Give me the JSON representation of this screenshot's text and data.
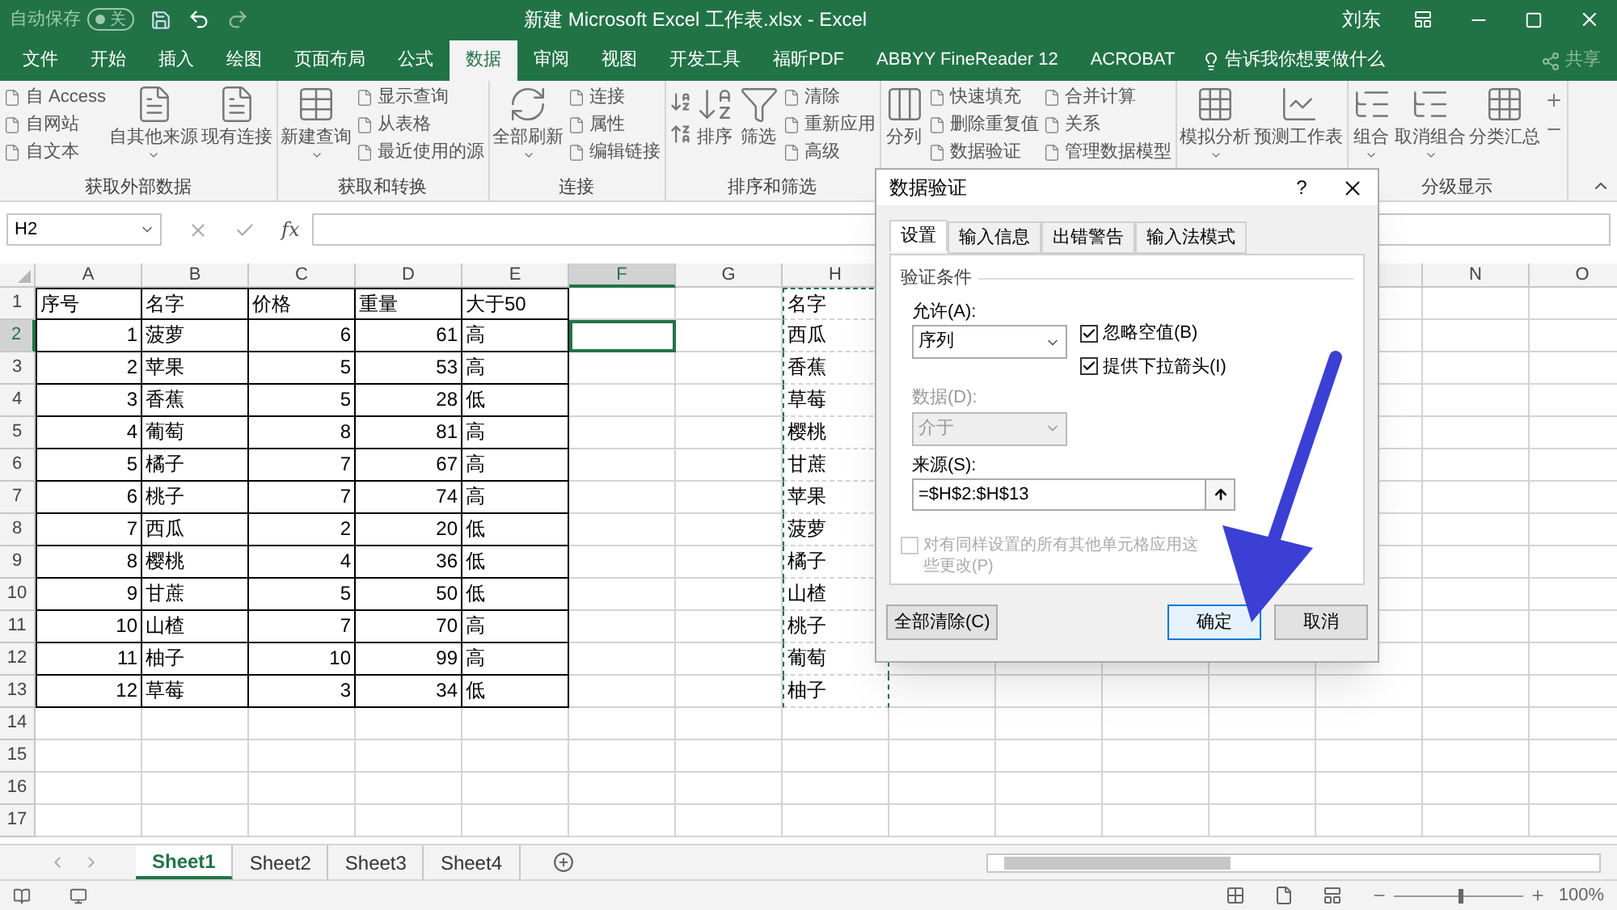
{
  "title_bar": {
    "autosave_label": "自动保存",
    "autosave_state": "关",
    "autosave_on": false,
    "document_title": "新建 Microsoft Excel 工作表.xlsx  -  Excel",
    "user": "刘东"
  },
  "ribbon_tabs": [
    {
      "label": "文件",
      "selected": false
    },
    {
      "label": "开始",
      "selected": false
    },
    {
      "label": "插入",
      "selected": false
    },
    {
      "label": "绘图",
      "selected": false
    },
    {
      "label": "页面布局",
      "selected": false
    },
    {
      "label": "公式",
      "selected": false
    },
    {
      "label": "数据",
      "selected": true
    },
    {
      "label": "审阅",
      "selected": false
    },
    {
      "label": "视图",
      "selected": false
    },
    {
      "label": "开发工具",
      "selected": false
    },
    {
      "label": "福昕PDF",
      "selected": false
    },
    {
      "label": "ABBYY FineReader 12",
      "selected": false
    },
    {
      "label": "ACROBAT",
      "selected": false
    }
  ],
  "tell_me": "告诉我你想要做什么",
  "share": "共享",
  "ribbon_groups": [
    {
      "label": "获取外部数据",
      "columns": [
        {
          "kind": "smalls",
          "items": [
            "自 Access",
            "自网站",
            "自文本"
          ]
        },
        {
          "kind": "large",
          "label": "自其他来源",
          "dropdown": true
        },
        {
          "kind": "large",
          "label": "现有连接",
          "dropdown": false
        }
      ]
    },
    {
      "label": "获取和转换",
      "columns": [
        {
          "kind": "large",
          "label": "新建查询",
          "dropdown": true
        },
        {
          "kind": "smalls",
          "items": [
            "显示查询",
            "从表格",
            "最近使用的源"
          ]
        }
      ]
    },
    {
      "label": "连接",
      "columns": [
        {
          "kind": "large",
          "label": "全部刷新",
          "dropdown": true
        },
        {
          "kind": "smalls",
          "items": [
            "连接",
            "属性",
            "编辑链接"
          ]
        }
      ]
    },
    {
      "label": "排序和筛选",
      "columns": [
        {
          "kind": "sort_icons"
        },
        {
          "kind": "large",
          "label": "排序",
          "dropdown": false
        },
        {
          "kind": "large",
          "label": "筛选",
          "dropdown": false
        },
        {
          "kind": "smalls",
          "items": [
            "清除",
            "重新应用",
            "高级"
          ]
        }
      ]
    },
    {
      "columns": [
        {
          "kind": "large",
          "label": "分列",
          "dropdown": false
        },
        {
          "kind": "smalls",
          "items": [
            "快速填充",
            "删除重复值",
            "数据验证"
          ]
        },
        {
          "kind": "smalls",
          "items": [
            "合并计算",
            "关系",
            "管理数据模型"
          ]
        }
      ]
    },
    {
      "columns": [
        {
          "kind": "large",
          "label": "模拟分析",
          "dropdown": true
        },
        {
          "kind": "large",
          "label": "预测工作表",
          "dropdown": false
        }
      ]
    },
    {
      "label": "分级显示",
      "columns": [
        {
          "kind": "large",
          "label": "组合",
          "dropdown": true
        },
        {
          "kind": "large",
          "label": "取消组合",
          "dropdown": true
        },
        {
          "kind": "large",
          "label": "分类汇总",
          "dropdown": false
        },
        {
          "kind": "outline_icons"
        }
      ]
    }
  ],
  "formula_bar": {
    "name_box": "H2",
    "function_label": "fx"
  },
  "sheet": {
    "columns": [
      {
        "label": "A",
        "selected": false,
        "numeric": true
      },
      {
        "label": "B",
        "selected": false,
        "numeric": false
      },
      {
        "label": "C",
        "selected": false,
        "numeric": true
      },
      {
        "label": "D",
        "selected": false,
        "numeric": true
      },
      {
        "label": "E",
        "selected": false,
        "numeric": false
      },
      {
        "label": "F",
        "selected": true
      },
      {
        "label": "G",
        "selected": false
      },
      {
        "label": "H",
        "selected": false
      }
    ],
    "right_columns": [
      {
        "label": "N",
        "selected": false
      },
      {
        "label": "O",
        "selected": false
      }
    ],
    "rows": [
      {
        "number": "1",
        "selected": false,
        "kind": "header",
        "table": [
          "序号",
          "名字",
          "价格",
          "重量",
          "大于50"
        ],
        "list": "名字"
      },
      {
        "number": "2",
        "selected": true,
        "kind": "record",
        "table": [
          "1",
          "菠萝",
          "6",
          "61",
          "高"
        ],
        "list": "西瓜"
      },
      {
        "number": "3",
        "selected": false,
        "kind": "record",
        "table": [
          "2",
          "苹果",
          "5",
          "53",
          "高"
        ],
        "list": "香蕉"
      },
      {
        "number": "4",
        "selected": false,
        "kind": "record",
        "table": [
          "3",
          "香蕉",
          "5",
          "28",
          "低"
        ],
        "list": "草莓"
      },
      {
        "number": "5",
        "selected": false,
        "kind": "record",
        "table": [
          "4",
          "葡萄",
          "8",
          "81",
          "高"
        ],
        "list": "樱桃"
      },
      {
        "number": "6",
        "selected": false,
        "kind": "record",
        "table": [
          "5",
          "橘子",
          "7",
          "67",
          "高"
        ],
        "list": "甘蔗"
      },
      {
        "number": "7",
        "selected": false,
        "kind": "record",
        "table": [
          "6",
          "桃子",
          "7",
          "74",
          "高"
        ],
        "list": "苹果"
      },
      {
        "number": "8",
        "selected": false,
        "kind": "record",
        "table": [
          "7",
          "西瓜",
          "2",
          "20",
          "低"
        ],
        "list": "菠萝"
      },
      {
        "number": "9",
        "selected": false,
        "kind": "record",
        "table": [
          "8",
          "樱桃",
          "4",
          "36",
          "低"
        ],
        "list": "橘子"
      },
      {
        "number": "10",
        "selected": false,
        "kind": "record",
        "table": [
          "9",
          "甘蔗",
          "5",
          "50",
          "低"
        ],
        "list": "山楂"
      },
      {
        "number": "11",
        "selected": false,
        "kind": "record",
        "table": [
          "10",
          "山楂",
          "7",
          "70",
          "高"
        ],
        "list": "桃子"
      },
      {
        "number": "12",
        "selected": false,
        "kind": "record",
        "table": [
          "11",
          "柚子",
          "10",
          "99",
          "高"
        ],
        "list": "葡萄"
      },
      {
        "number": "13",
        "selected": false,
        "kind": "record",
        "table": [
          "12",
          "草莓",
          "3",
          "34",
          "低"
        ],
        "list": "柚子"
      },
      {
        "number": "14",
        "selected": false
      },
      {
        "number": "15",
        "selected": false
      },
      {
        "number": "16",
        "selected": false
      },
      {
        "number": "17",
        "selected": false
      }
    ]
  },
  "sheet_tabs": [
    {
      "label": "Sheet1",
      "selected": true
    },
    {
      "label": "Sheet2",
      "selected": false
    },
    {
      "label": "Sheet3",
      "selected": false
    },
    {
      "label": "Sheet4",
      "selected": false
    }
  ],
  "status_bar": {
    "zoom": {
      "level": 0.5,
      "reading": "100%"
    }
  },
  "dialog": {
    "title": "数据验证",
    "help": "?",
    "tabs": [
      {
        "label": "设置",
        "selected": true
      },
      {
        "label": "输入信息",
        "selected": false
      },
      {
        "label": "出错警告",
        "selected": false
      },
      {
        "label": "输入法模式",
        "selected": false
      }
    ],
    "section": "验证条件",
    "allow": {
      "label": "允许(A):",
      "value": "序列"
    },
    "checkboxes": [
      {
        "label": "忽略空值(B)",
        "checked": true
      },
      {
        "label": "提供下拉箭头(I)",
        "checked": true
      }
    ],
    "data": {
      "label": "数据(D):",
      "value": "介于",
      "disabled": true
    },
    "source": {
      "label": "来源(S):",
      "value": "=$H$2:$H$13"
    },
    "apply_all": {
      "label": "对有同样设置的所有其他单元格应用这些更改(P)",
      "checked": false,
      "disabled": true
    },
    "buttons": [
      {
        "label": "全部清除(C)",
        "kind": "left"
      },
      {
        "label": "确定",
        "kind": "default"
      },
      {
        "label": "取消",
        "kind": "normal"
      }
    ]
  }
}
